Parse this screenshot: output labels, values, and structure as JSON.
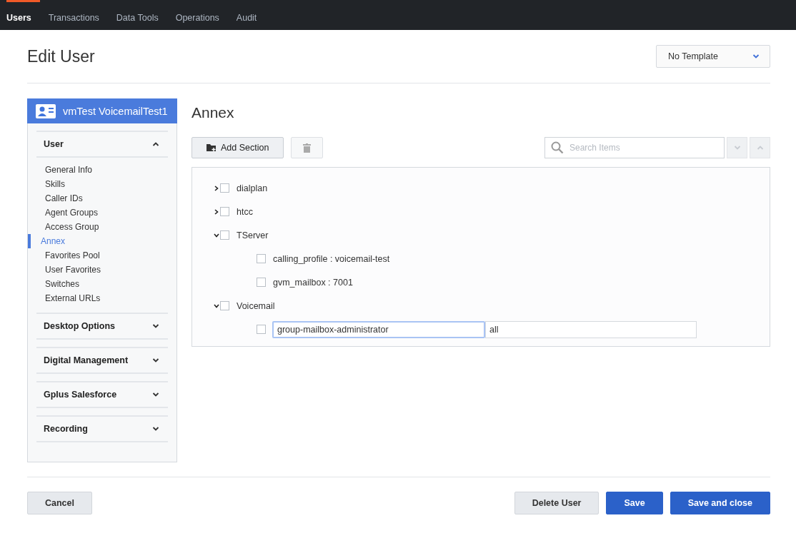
{
  "nav": {
    "tabs": [
      {
        "label": "Users",
        "selected": true
      },
      {
        "label": "Transactions",
        "selected": false
      },
      {
        "label": "Data Tools",
        "selected": false
      },
      {
        "label": "Operations",
        "selected": false
      },
      {
        "label": "Audit",
        "selected": false
      }
    ]
  },
  "header": {
    "title": "Edit User",
    "template": "No Template"
  },
  "sidebar": {
    "user_name": "vmTest VoicemailTest1",
    "sections": [
      {
        "title": "User",
        "expanded": true,
        "items": [
          {
            "label": "General Info",
            "selected": false
          },
          {
            "label": "Skills",
            "selected": false
          },
          {
            "label": "Caller IDs",
            "selected": false
          },
          {
            "label": "Agent Groups",
            "selected": false
          },
          {
            "label": "Access Group",
            "selected": false
          },
          {
            "label": "Annex",
            "selected": true
          },
          {
            "label": "Favorites Pool",
            "selected": false
          },
          {
            "label": "User Favorites",
            "selected": false
          },
          {
            "label": "Switches",
            "selected": false
          },
          {
            "label": "External URLs",
            "selected": false
          }
        ]
      },
      {
        "title": "Desktop Options",
        "expanded": false
      },
      {
        "title": "Digital Management",
        "expanded": false
      },
      {
        "title": "Gplus Salesforce",
        "expanded": false
      },
      {
        "title": "Recording",
        "expanded": false
      }
    ]
  },
  "content": {
    "title": "Annex",
    "add_section": "Add Section",
    "search": {
      "placeholder": "Search Items"
    },
    "tree": [
      {
        "kind": "section",
        "label": "dialplan",
        "expanded": false,
        "checked": false
      },
      {
        "kind": "section",
        "label": "htcc",
        "expanded": false,
        "checked": false
      },
      {
        "kind": "section",
        "label": "TServer",
        "expanded": true,
        "checked": false,
        "children": [
          {
            "kind": "entry",
            "label": "calling_profile : voicemail-test",
            "checked": false
          },
          {
            "kind": "entry",
            "label": "gvm_mailbox : 7001",
            "checked": false
          }
        ]
      },
      {
        "kind": "section",
        "label": "Voicemail",
        "expanded": true,
        "checked": false,
        "children": [
          {
            "kind": "edit",
            "key": "group-mailbox-administrator",
            "value": "all",
            "checked": false
          }
        ]
      }
    ]
  },
  "footer": {
    "left": [
      {
        "label": "Cancel",
        "kind": "secondary"
      }
    ],
    "right": [
      {
        "label": "Delete User",
        "kind": "secondary"
      },
      {
        "label": "Save",
        "kind": "primary"
      },
      {
        "label": "Save and close",
        "kind": "primary"
      }
    ]
  }
}
